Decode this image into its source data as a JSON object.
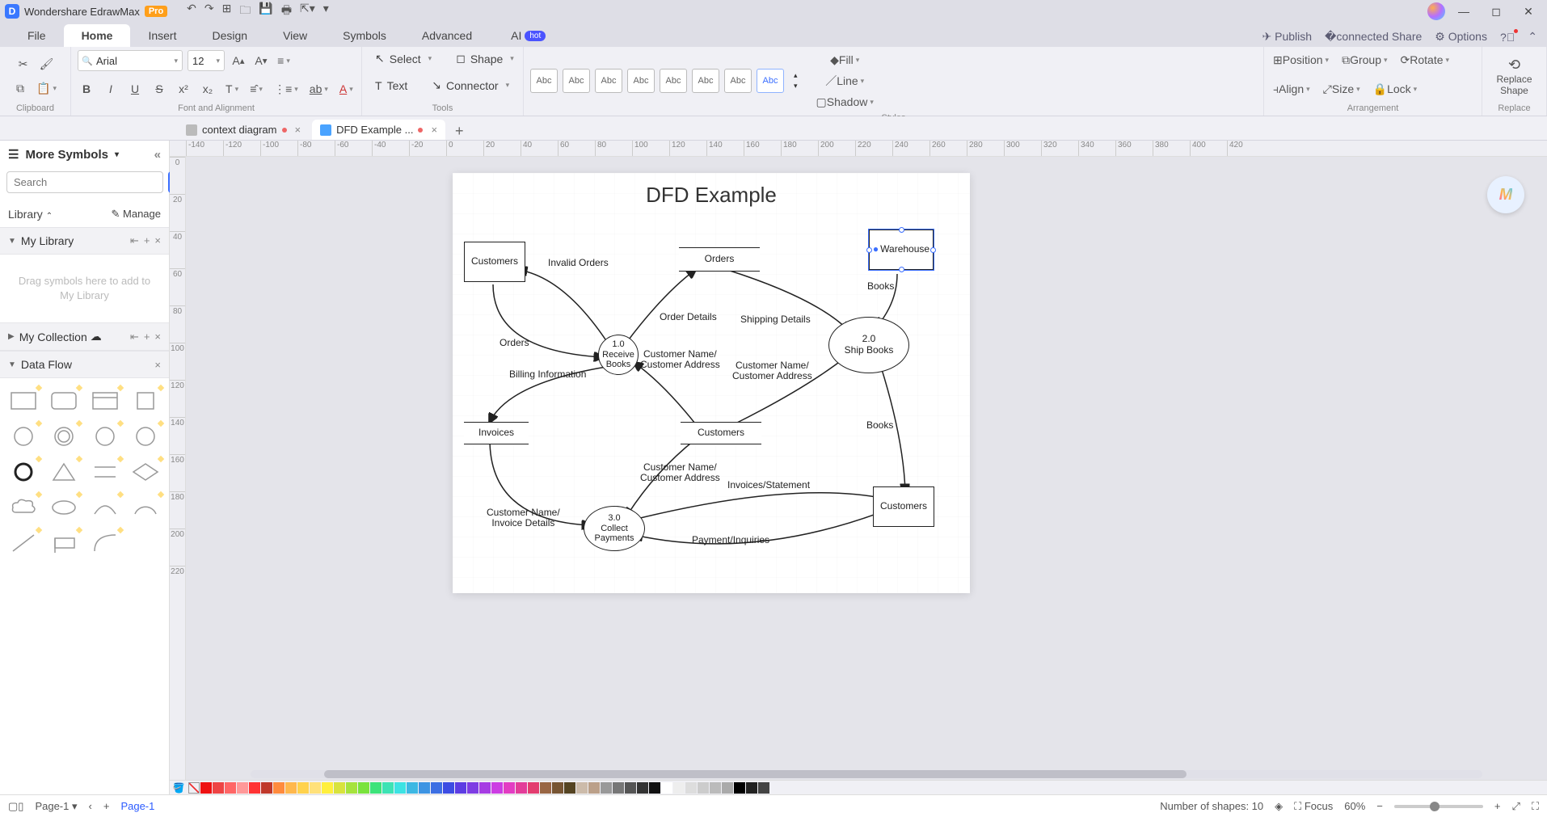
{
  "titlebar": {
    "app_name": "Wondershare EdrawMax",
    "badge": "Pro"
  },
  "menubar": {
    "tabs": [
      "File",
      "Home",
      "Insert",
      "Design",
      "View",
      "Symbols",
      "Advanced"
    ],
    "active_index": 1,
    "ai_label": "AI",
    "ai_badge": "hot",
    "right": {
      "publish": "Publish",
      "share": "Share",
      "options": "Options"
    }
  },
  "ribbon": {
    "clipboard_label": "Clipboard",
    "font_label": "Font and Alignment",
    "font_name": "Arial",
    "font_size": "12",
    "tools_label": "Tools",
    "select": "Select",
    "shape": "Shape",
    "text": "Text",
    "connector": "Connector",
    "styles_label": "Styles",
    "style_cells": [
      "Abc",
      "Abc",
      "Abc",
      "Abc",
      "Abc",
      "Abc",
      "Abc",
      "Abc"
    ],
    "fill": "Fill",
    "line": "Line",
    "shadow": "Shadow",
    "arrangement_label": "Arrangement",
    "position": "Position",
    "group": "Group",
    "rotate": "Rotate",
    "align": "Align",
    "size": "Size",
    "lock": "Lock",
    "replace_label": "Replace",
    "replace_shape": "Replace\nShape"
  },
  "doctabs": {
    "tabs": [
      {
        "title": "context diagram",
        "active": false,
        "dirty": true
      },
      {
        "title": "DFD Example ...",
        "active": true,
        "dirty": true
      }
    ]
  },
  "leftpanel": {
    "title": "More Symbols",
    "search_placeholder": "Search",
    "search_button": "Search",
    "library_label": "Library",
    "manage": "Manage",
    "mylib": "My Library",
    "mycol": "My Collection",
    "dataflow": "Data Flow",
    "empty": "Drag symbols here to add to My Library"
  },
  "hruler_ticks": [
    -140,
    -120,
    -100,
    -80,
    -60,
    -40,
    -20,
    0,
    20,
    40,
    60,
    80,
    100,
    120,
    140,
    160,
    180,
    200,
    220,
    240,
    260,
    280,
    300,
    320,
    340,
    360,
    380,
    400,
    420
  ],
  "vruler_ticks": [
    0,
    20,
    40,
    60,
    80,
    100,
    120,
    140,
    160,
    180,
    200,
    220
  ],
  "diagram": {
    "title": "DFD Example",
    "entities": {
      "customers1": "Customers",
      "warehouse": "Warehouse",
      "customers2": "Customers"
    },
    "stores": {
      "orders": "Orders",
      "invoices": "Invoices",
      "customers": "Customers"
    },
    "processes": {
      "p1": "1.0\nReceive Books",
      "p2": "2.0\nShip Books",
      "p3": "3.0\nCollect Payments"
    },
    "labels": {
      "invalid_orders": "Invalid Orders",
      "orders_flow": "Orders",
      "billing_info": "Billing Information",
      "order_details": "Order Details",
      "shipping_details": "Shipping Details",
      "cust_addr1": "Customer Name/\nCustomer Address",
      "cust_addr2": "Customer Name/\nCustomer Address",
      "cust_addr3": "Customer Name/\nCustomer Address",
      "cust_invoice": "Customer Name/\nInvoice Details",
      "books1": "Books",
      "books2": "Books",
      "inv_stmt": "Invoices/Statement",
      "pay_inq": "Payment/Inquiries"
    }
  },
  "colorstrip": [
    "#e11",
    "#e44",
    "#f66",
    "#f99",
    "#f33",
    "#c0392b",
    "#ff8b3d",
    "#ffb84d",
    "#ffd24d",
    "#ffe17a",
    "#ffef3d",
    "#d8e33d",
    "#a6e33d",
    "#7ae33d",
    "#3de37a",
    "#3de3b4",
    "#3de3e3",
    "#3db8e3",
    "#3d94e3",
    "#3d6fe3",
    "#3d4de3",
    "#5d3de3",
    "#7e3de3",
    "#a63de3",
    "#cc3de3",
    "#e33dc3",
    "#e33d99",
    "#e33d6f",
    "#996644",
    "#775533",
    "#554422",
    "#ccbbaa",
    "#bba089",
    "#999999",
    "#777777",
    "#555555",
    "#333333",
    "#111111",
    "#ffffff",
    "#eeeeee",
    "#dddddd",
    "#cccccc",
    "#bbbbbb",
    "#aaaaaa",
    "#000000",
    "#222222",
    "#444444"
  ],
  "statusbar": {
    "page_tab": "Page-1",
    "page_current": "Page-1",
    "shapes": "Number of shapes: 10",
    "focus": "Focus",
    "zoom": "60%"
  }
}
